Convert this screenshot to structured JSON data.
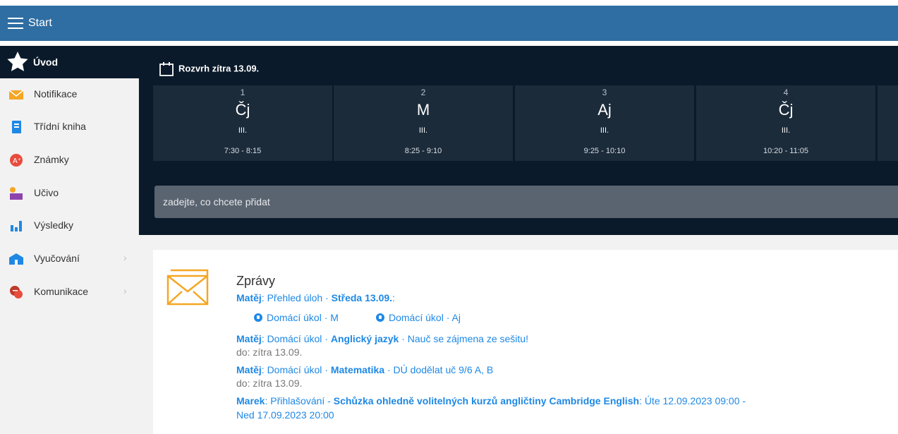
{
  "topbar": {
    "title": "Start"
  },
  "sidebar": {
    "active": {
      "label": "Úvod"
    },
    "items": [
      {
        "label": "Notifikace",
        "icon": "envelope-icon",
        "color": "#f5a623"
      },
      {
        "label": "Třídní kniha",
        "icon": "book-icon",
        "color": "#1e88e5"
      },
      {
        "label": "Známky",
        "icon": "grades-icon",
        "color": "#e74c3c"
      },
      {
        "label": "Učivo",
        "icon": "teacher-icon",
        "color": "#8e44ad"
      },
      {
        "label": "Výsledky",
        "icon": "bar-chart-icon",
        "color": "#1e88e5"
      },
      {
        "label": "Vyučování",
        "icon": "school-icon",
        "color": "#1e88e5",
        "chevron": "›"
      },
      {
        "label": "Komunikace",
        "icon": "chat-icon",
        "color": "#c0392b",
        "chevron": "›"
      }
    ]
  },
  "schedule": {
    "title": "Rozvrh zítra 13.09.",
    "lessons": [
      {
        "num": "1",
        "subject": "Čj",
        "room": "III.",
        "time": "7:30 - 8:15"
      },
      {
        "num": "2",
        "subject": "M",
        "room": "III.",
        "time": "8:25 - 9:10"
      },
      {
        "num": "3",
        "subject": "Aj",
        "room": "III.",
        "time": "9:25 - 10:10"
      },
      {
        "num": "4",
        "subject": "Čj",
        "room": "III.",
        "time": "10:20 - 11:05"
      }
    ]
  },
  "add": {
    "placeholder": "zadejte, co chcete přidat"
  },
  "messages": {
    "title": "Zprávy",
    "l1": {
      "name": "Matěj",
      "sep1": ": Přehled úloh · ",
      "day": "Středa 13.09.",
      "end": ":"
    },
    "hw1": "Domácí úkol · M",
    "hw2": "Domácí úkol · Aj",
    "l2": {
      "name": "Matěj",
      "sep1": ": Domácí úkol · ",
      "subj": "Anglický jazyk",
      "text": " · Nauč se zájmena ze sešitu!"
    },
    "l2due": "do: zítra 13.09.",
    "l3": {
      "name": "Matěj",
      "sep1": ": Domácí úkol · ",
      "subj": "Matematika",
      "text": " · DÚ dodělat uč 9/6 A, B"
    },
    "l3due": "do: zítra 13.09.",
    "l4": {
      "name": "Marek",
      "sep1": ": Přihlašování - ",
      "subj": "Schůzka ohledně volitelných kurzů angličtiny Cambridge English",
      "text": ": Úte 12.09.2023 09:00 -"
    },
    "l4b": "Ned 17.09.2023 20:00"
  }
}
